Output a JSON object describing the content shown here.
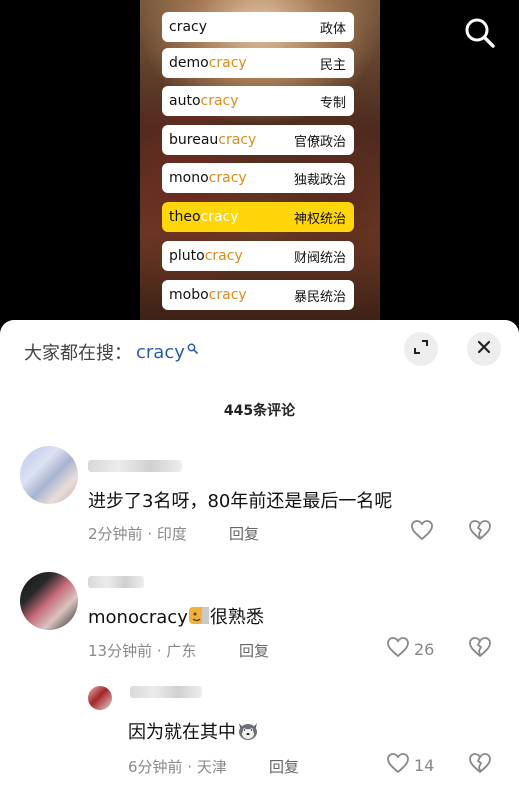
{
  "video": {
    "items": [
      {
        "prefix": "",
        "suffix": "cracy",
        "zh": "政体"
      },
      {
        "prefix": "demo",
        "suffix": "cracy",
        "zh": "民主"
      },
      {
        "prefix": "auto",
        "suffix": "cracy",
        "zh": "专制"
      },
      {
        "prefix": "bureau",
        "suffix": "cracy",
        "zh": "官僚政治"
      },
      {
        "prefix": "mono",
        "suffix": "cracy",
        "zh": "独裁政治"
      },
      {
        "prefix": "theo",
        "suffix": "cracy",
        "zh": "神权统治"
      },
      {
        "prefix": "pluto",
        "suffix": "cracy",
        "zh": "财阀统治"
      },
      {
        "prefix": "mobo",
        "suffix": "cracy",
        "zh": "暴民统治"
      }
    ],
    "highlight_color": "#ffd60a",
    "suffix_color": "#e08a1a"
  },
  "search": {
    "prefix": "大家都在搜：",
    "term": "cracy"
  },
  "comments_count": "445条评论",
  "comments": [
    {
      "text": "进步了3名呀，80年前还是最后一名呢",
      "time": "2分钟前",
      "location": "印度",
      "reply": "回复",
      "likes": ""
    },
    {
      "text": "monocracy",
      "text2": "很熟悉",
      "time": "13分钟前",
      "location": "广东",
      "reply": "回复",
      "likes": "26"
    },
    {
      "text": "因为就在其中",
      "time": "6分钟前",
      "location": "天津",
      "reply": "回复",
      "likes": "14"
    }
  ],
  "icons": {
    "search": "search-icon",
    "expand": "expand-icon",
    "close": "close-icon",
    "like": "heart-icon",
    "dislike": "broken-heart-icon"
  },
  "colors": {
    "search_term": "#2a5db0"
  }
}
